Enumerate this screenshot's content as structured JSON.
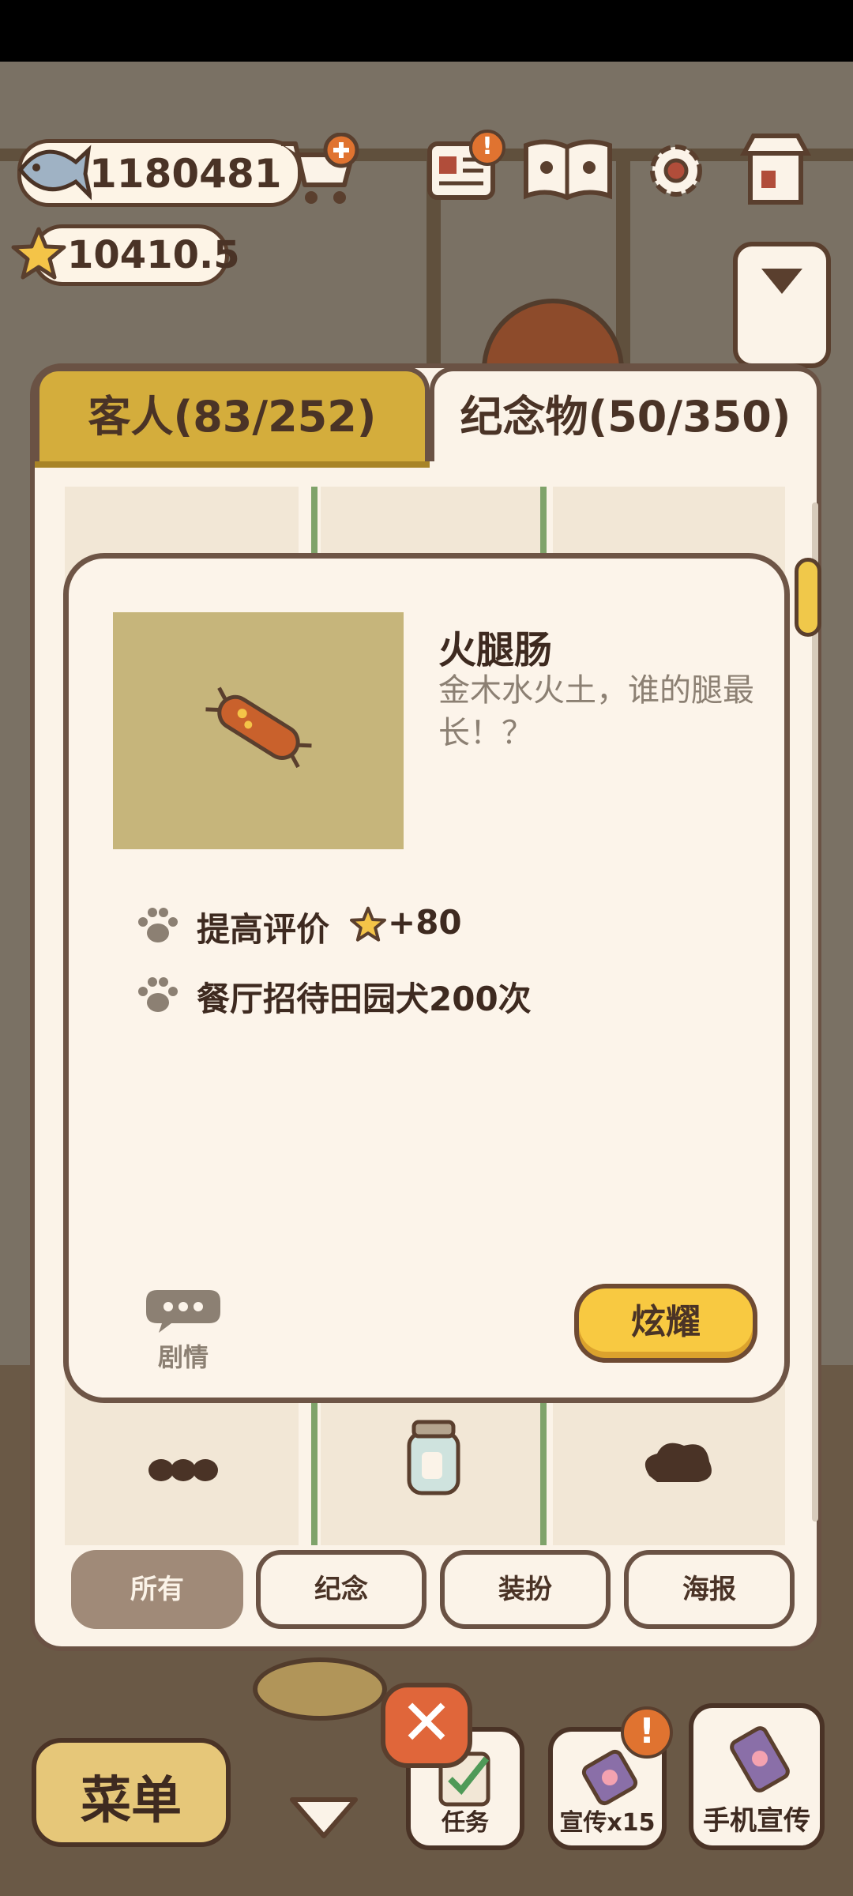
{
  "hud": {
    "fish_count": "1180481",
    "star_rating": "10410.5"
  },
  "tabs": {
    "guests": "客人(83/252)",
    "souvenirs": "纪念物(50/350)"
  },
  "item": {
    "name": "火腿肠",
    "description": "金木水火土，谁的腿最长！？",
    "effects": [
      {
        "text": "提高评价",
        "bonus": "+80"
      },
      {
        "text": "餐厅招待田园犬200次"
      }
    ],
    "story_label": "剧情",
    "show_label": "炫耀"
  },
  "filters": [
    "所有",
    "纪念",
    "装扮",
    "海报"
  ],
  "bottom": {
    "menu_label": "菜单",
    "tasks_label": "任务",
    "promo_label": "宣传x15",
    "phone_promo_label": "手机宣传",
    "close_symbol": "✕"
  },
  "colors": {
    "accent_yellow": "#f8c941",
    "tab_gold": "#d4ad3c",
    "panel_bg": "#fbf3e8",
    "border_brown": "#6a5244",
    "alert_orange": "#e07330"
  }
}
